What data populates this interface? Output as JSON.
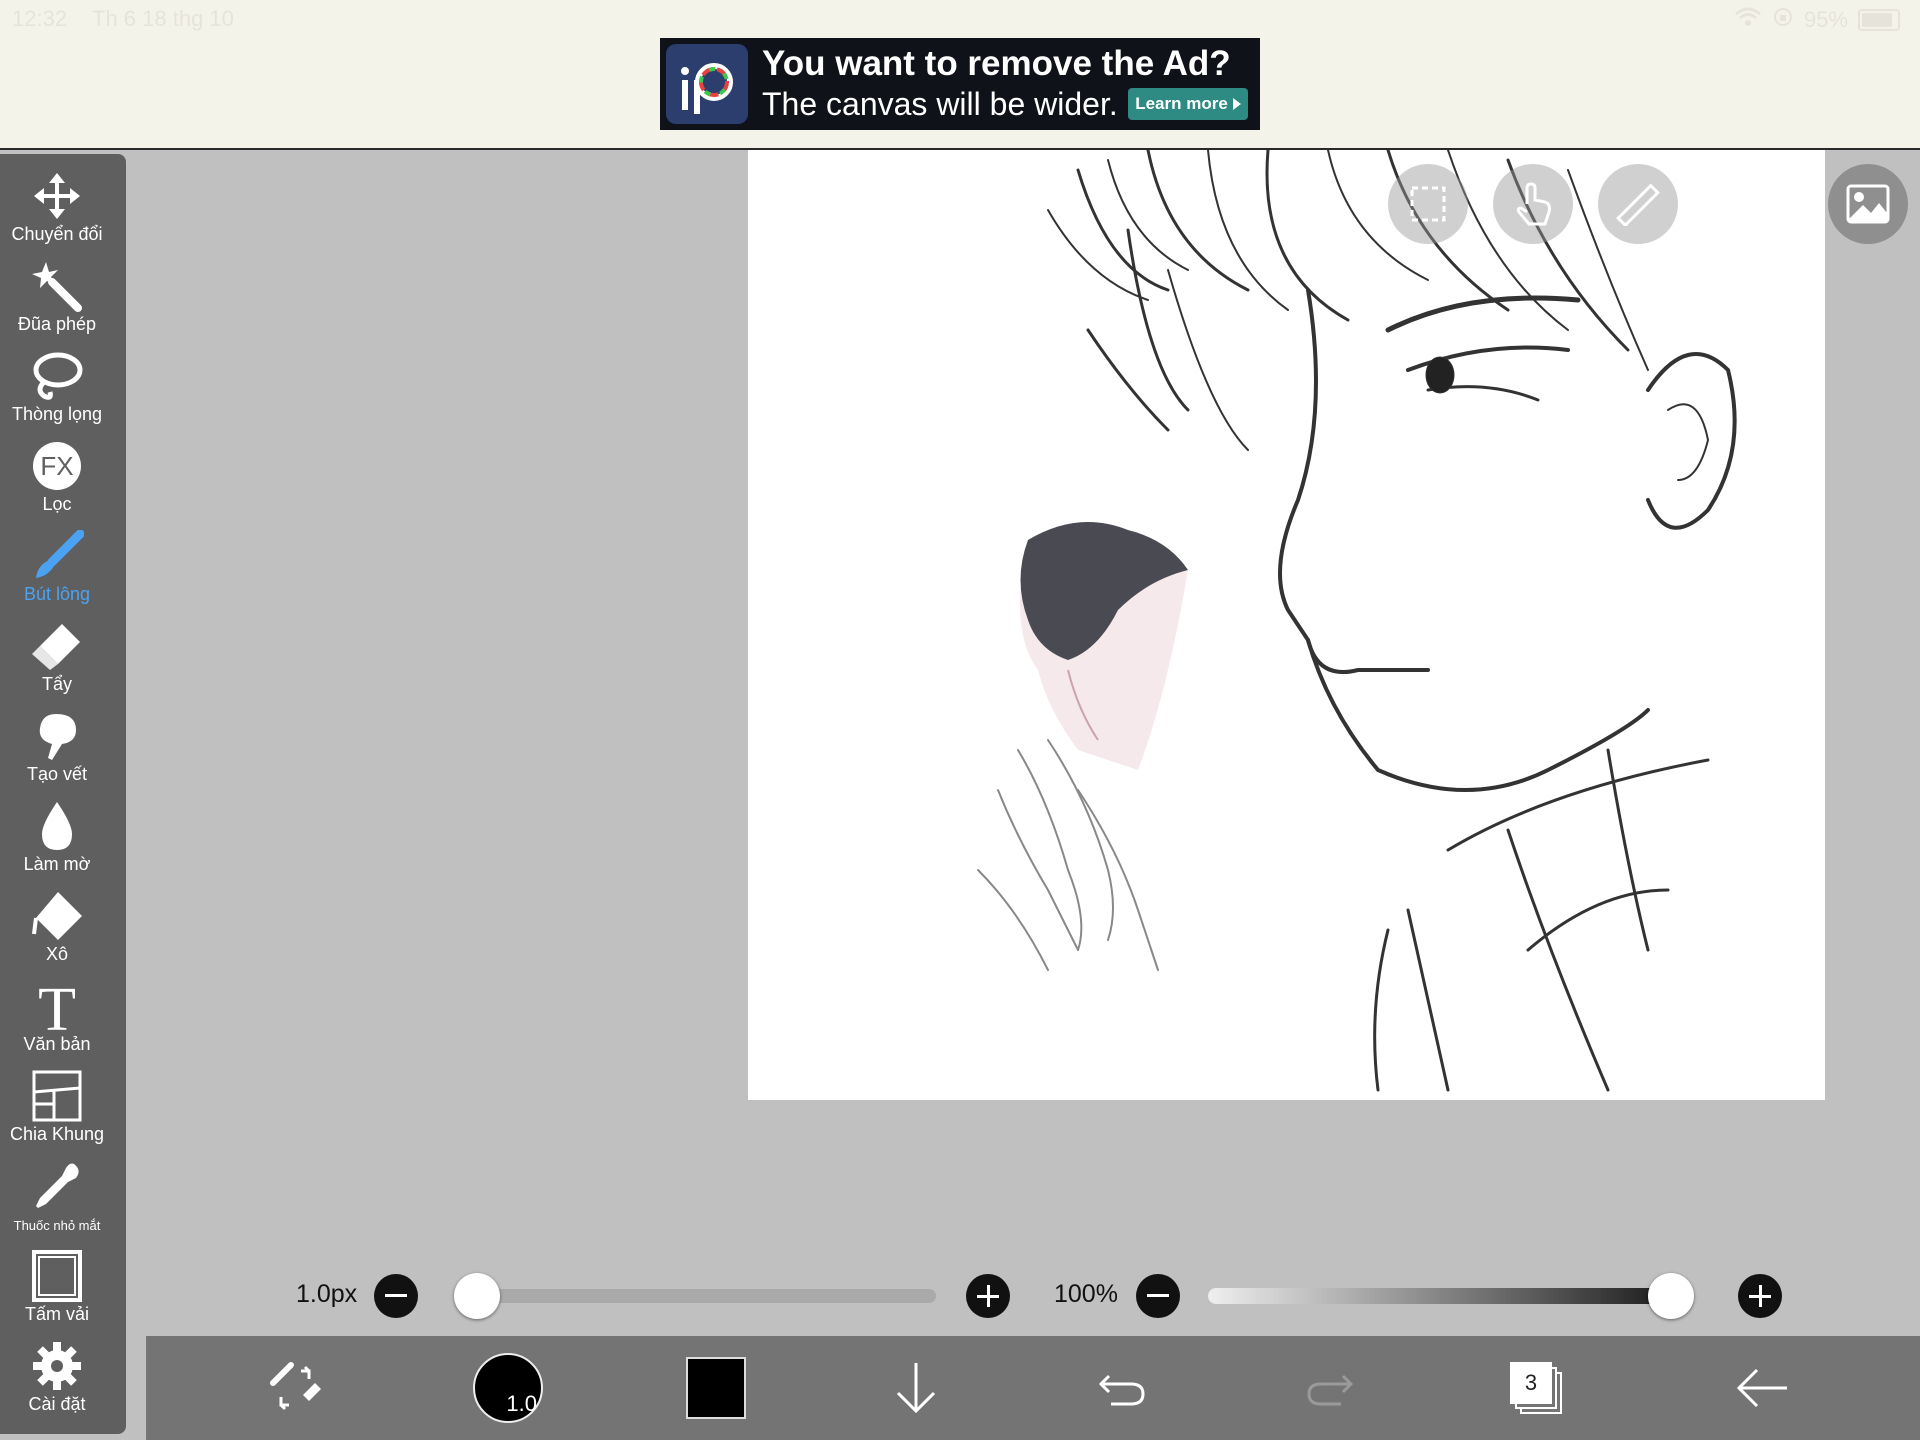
{
  "status_bar": {
    "time": "12:32",
    "date": "Th 6 18 thg 10",
    "battery": "95%"
  },
  "ad": {
    "title": "You want to remove the Ad?",
    "subtitle": "The canvas will be wider.",
    "button": "Learn more"
  },
  "toolbar": {
    "items": [
      {
        "label": "Chuyển đổi",
        "icon": "move-arrows-icon"
      },
      {
        "label": "Đũa phép",
        "icon": "magic-wand-icon"
      },
      {
        "label": "Thòng lọng",
        "icon": "lasso-icon"
      },
      {
        "label": "Lọc",
        "icon": "fx-filter-icon"
      },
      {
        "label": "Bút lông",
        "icon": "brush-icon",
        "active": true
      },
      {
        "label": "Tẩy",
        "icon": "eraser-icon"
      },
      {
        "label": "Tạo vết",
        "icon": "smudge-icon"
      },
      {
        "label": "Làm mờ",
        "icon": "blur-drop-icon"
      },
      {
        "label": "Xô",
        "icon": "bucket-icon"
      },
      {
        "label": "Văn bản",
        "icon": "text-T-icon"
      },
      {
        "label": "Chia Khung",
        "icon": "frame-divider-icon"
      },
      {
        "label": "Thuốc nhỏ mắt",
        "icon": "eyedropper-icon"
      },
      {
        "label": "Tấm vải",
        "icon": "canvas-icon"
      },
      {
        "label": "Cài đặt",
        "icon": "gear-icon"
      }
    ]
  },
  "sliders": {
    "size_label": "1.0px",
    "size_value": 0.0,
    "opacity_label": "100%",
    "opacity_value": 100
  },
  "bottom_bar": {
    "brush_size": "1.0",
    "layer_count": "3",
    "primary_color": "#000000"
  },
  "colors": {
    "active_tool": "#4aa3f2",
    "ad_button": "#2e8b83"
  }
}
